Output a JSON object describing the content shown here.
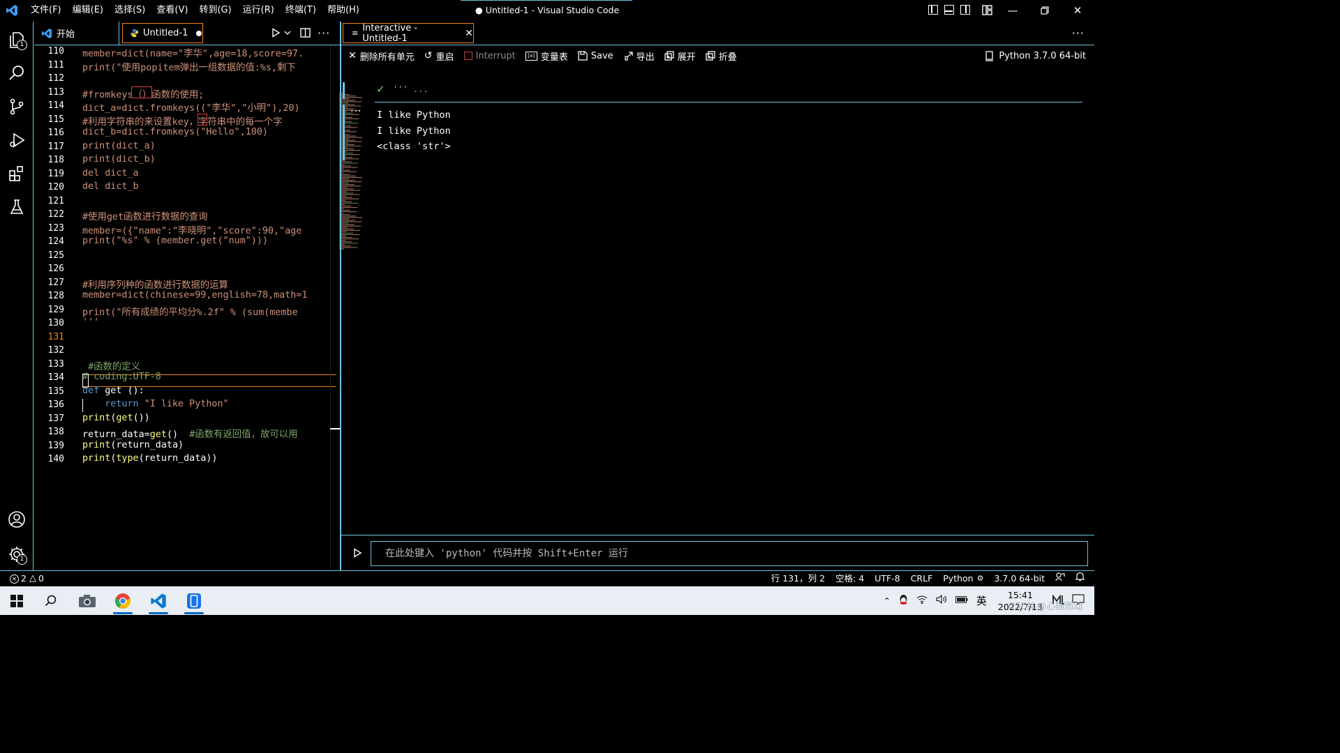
{
  "app": {
    "window_title": "● Untitled-1 - Visual Studio Code",
    "menu": [
      "文件(F)",
      "编辑(E)",
      "选择(S)",
      "查看(V)",
      "转到(G)",
      "运行(R)",
      "终端(T)",
      "帮助(H)"
    ]
  },
  "activity": {
    "explorer_badge": "1",
    "settings_badge": "1"
  },
  "editor": {
    "tabs": [
      {
        "label": "开始"
      },
      {
        "label": "Untitled-1",
        "dirty": true
      }
    ],
    "active_line": "131",
    "lines": [
      {
        "n": "110",
        "t": "member=dict(name=\"李华\",age=18,score=97."
      },
      {
        "n": "111",
        "t": "print(\"使用popitem弹出一组数据的值:%s,剩下"
      },
      {
        "n": "112",
        "t": ""
      },
      {
        "n": "113",
        "t": "#fromkeys（）函数的使用;"
      },
      {
        "n": "114",
        "t": "dict_a=dict.fromkeys((\"李华\",\"小明\"),20)"
      },
      {
        "n": "115",
        "t": "#利用字符串的来设置key，字符串中的每一个字"
      },
      {
        "n": "116",
        "t": "dict_b=dict.fromkeys(\"Hello\",100)"
      },
      {
        "n": "117",
        "t": "print(dict_a)"
      },
      {
        "n": "118",
        "t": "print(dict_b)"
      },
      {
        "n": "119",
        "t": "del dict_a"
      },
      {
        "n": "120",
        "t": "del dict_b"
      },
      {
        "n": "121",
        "t": ""
      },
      {
        "n": "122",
        "t": "#使用get函数进行数据的查询"
      },
      {
        "n": "123",
        "t": "member=({\"name\":\"李晓明\",\"score\":90,\"age"
      },
      {
        "n": "124",
        "t": "print(\"%s\" % (member.get(\"num\")))"
      },
      {
        "n": "125",
        "t": ""
      },
      {
        "n": "126",
        "t": ""
      },
      {
        "n": "127",
        "t": "#利用序列种的函数进行数据的运算"
      },
      {
        "n": "128",
        "t": "member=dict(chinese=99,english=78,math=1"
      },
      {
        "n": "129",
        "t": "print(\"所有成绩的平均分%.2f\" % (sum(membe"
      },
      {
        "n": "130",
        "t": "'''"
      },
      {
        "n": "131",
        "t": ""
      },
      {
        "n": "132",
        "t": ""
      },
      {
        "n": "133",
        "t": " #函数的定义"
      },
      {
        "n": "134",
        "t": "# coding:UTF-8"
      },
      {
        "n": "135",
        "t": "def get ():"
      },
      {
        "n": "136",
        "t": "    return \"I like Python\""
      },
      {
        "n": "137",
        "t": "print(get())"
      },
      {
        "n": "138",
        "t": "return_data=get()  #函数有返回值，故可以用"
      },
      {
        "n": "139",
        "t": "print(return_data)"
      },
      {
        "n": "140",
        "t": "print(type(return_data))"
      }
    ]
  },
  "interactive": {
    "tab_label": "Interactive - Untitled-1",
    "toolbar": [
      {
        "icon": "close-icon",
        "label": "删除所有单元"
      },
      {
        "icon": "restart-icon",
        "label": "重启"
      },
      {
        "icon": "interrupt-icon",
        "label": "Interrupt",
        "disabled": true
      },
      {
        "icon": "variables-icon",
        "label": "变量表"
      },
      {
        "icon": "save-icon",
        "label": "Save"
      },
      {
        "icon": "export-icon",
        "label": "导出"
      },
      {
        "icon": "expand-icon",
        "label": "展开"
      },
      {
        "icon": "collapse-icon",
        "label": "折叠"
      }
    ],
    "kernel": "Python 3.7.0 64-bit",
    "cell_code": "''' ...",
    "output": [
      "I like Python",
      "I like Python",
      "<class 'str'>"
    ],
    "input_placeholder": "在此处键入 'python' 代码并按 Shift+Enter 运行"
  },
  "status": {
    "errors": "2",
    "warnings": "0",
    "position": "行 131，列 2",
    "spaces": "空格: 4",
    "encoding": "UTF-8",
    "eol": "CRLF",
    "language": "Python",
    "interpreter": "3.7.0 64-bit"
  },
  "taskbar": {
    "ime": "英",
    "time": "15:41",
    "date": "2022/7/13",
    "watermark": "CSDN @心随而动"
  }
}
